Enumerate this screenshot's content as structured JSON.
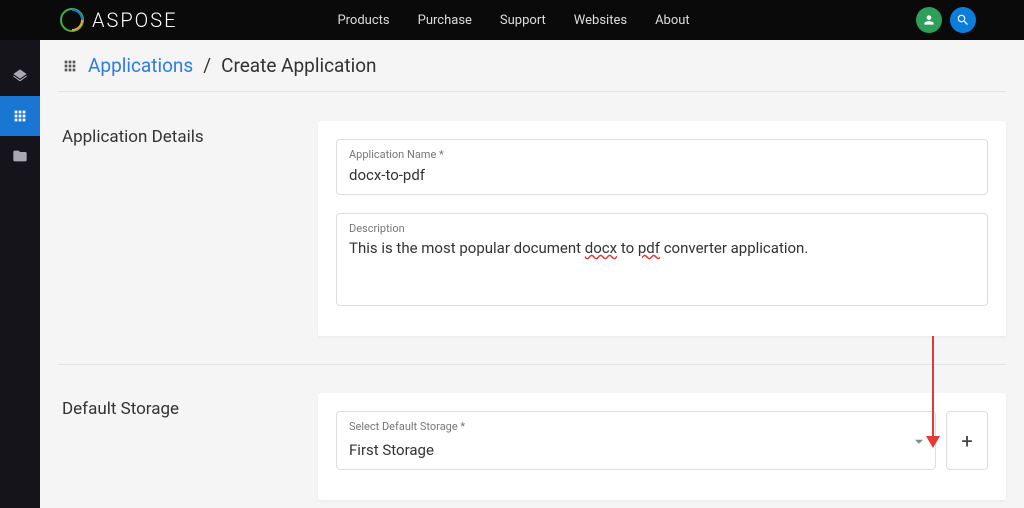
{
  "header": {
    "logo_text": "ASPOSE",
    "nav": [
      "Products",
      "Purchase",
      "Support",
      "Websites",
      "About"
    ]
  },
  "breadcrumb": {
    "link": "Applications",
    "separator": "/",
    "current": "Create Application"
  },
  "sections": {
    "app_details": {
      "title": "Application Details",
      "name_label": "Application Name *",
      "name_value": "docx-to-pdf",
      "desc_label": "Description",
      "desc_prefix": "This is the most popular document ",
      "desc_w1": "docx",
      "desc_mid": " to ",
      "desc_w2": "pdf",
      "desc_suffix": " converter application."
    },
    "storage": {
      "title": "Default Storage",
      "select_label": "Select Default Storage *",
      "selected": "First Storage",
      "add_label": "+"
    }
  }
}
